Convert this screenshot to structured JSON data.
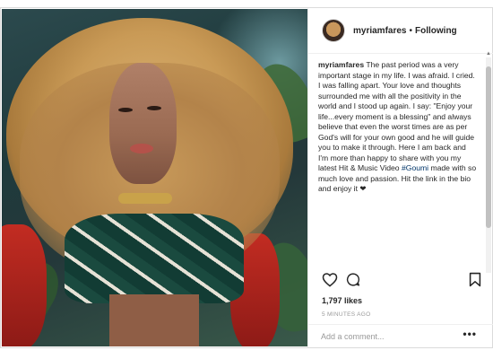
{
  "post": {
    "username": "myriamfares",
    "separator": "•",
    "follow_status": "Following",
    "caption_username": "myriamfares",
    "caption_part1": " The past period was a very important stage in my life. I was afraid. I cried. I was falling apart. Your love and thoughts surrounded me with all the positivity in the world and I stood up again. I say: \"Enjoy your life...every moment is a blessing\" and always believe that even the worst times are as per God's will for your own good and he will guide you to make it through. Here I am back and I'm more than happy to share with you my latest Hit & Music Video ",
    "hashtag": "#Goumi",
    "caption_part2": " made with so much love and passion. Hit the link in the bio and enjoy it ❤",
    "likes": "1,797 likes",
    "timestamp": "5 MINUTES AGO",
    "comment_placeholder": "Add a comment...",
    "more_label": "•••"
  },
  "icons": {
    "like": "heart-icon",
    "comment": "comment-icon",
    "share": "share-icon",
    "save": "bookmark-icon"
  }
}
